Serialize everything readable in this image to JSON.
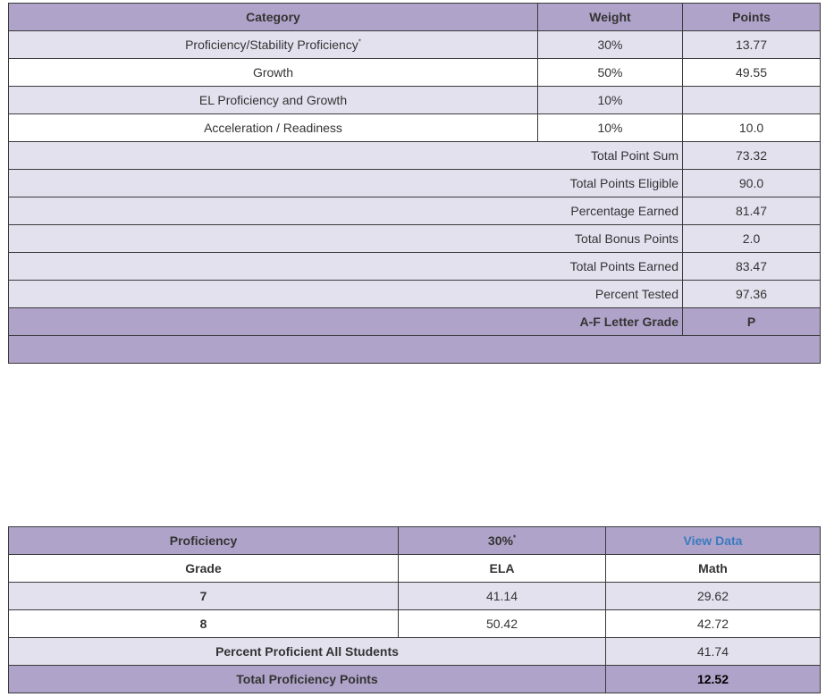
{
  "grade_table": {
    "headers": [
      "Category",
      "Weight",
      "Points"
    ],
    "rows": [
      {
        "category": "Proficiency/Stability Proficiency",
        "footnote": "*",
        "weight": "30%",
        "points": "13.77"
      },
      {
        "category": "Growth",
        "weight": "50%",
        "points": "49.55"
      },
      {
        "category": "EL Proficiency and Growth",
        "weight": "10%",
        "points": ""
      },
      {
        "category": "Acceleration / Readiness",
        "weight": "10%",
        "points": "10.0"
      }
    ],
    "summary": [
      {
        "label": "Total Point Sum",
        "value": "73.32"
      },
      {
        "label": "Total Points Eligible",
        "value": "90.0"
      },
      {
        "label": "Percentage Earned",
        "value": "81.47"
      },
      {
        "label": "Total Bonus Points",
        "value": "2.0"
      },
      {
        "label": "Total Points Earned",
        "value": "83.47"
      },
      {
        "label": "Percent Tested",
        "value": "97.36"
      }
    ],
    "letter_grade": {
      "label": "A-F Letter Grade",
      "value": "P"
    }
  },
  "proficiency_table": {
    "title": "Proficiency",
    "weight": "30%",
    "weight_footnote": "*",
    "view_data_link": "View Data",
    "subheaders": [
      "Grade",
      "ELA",
      "Math"
    ],
    "rows": [
      {
        "grade": "7",
        "ela": "41.14",
        "math": "29.62"
      },
      {
        "grade": "8",
        "ela": "50.42",
        "math": "42.72"
      }
    ],
    "percent_all": {
      "label": "Percent Proficient All Students",
      "value": "41.74"
    },
    "total": {
      "label": "Total Proficiency Points",
      "value": "12.52"
    }
  },
  "colors": {
    "header_purple": "#b0a3c9",
    "light_lavender": "#e4e1ef",
    "link_blue": "#3a7bbf"
  }
}
